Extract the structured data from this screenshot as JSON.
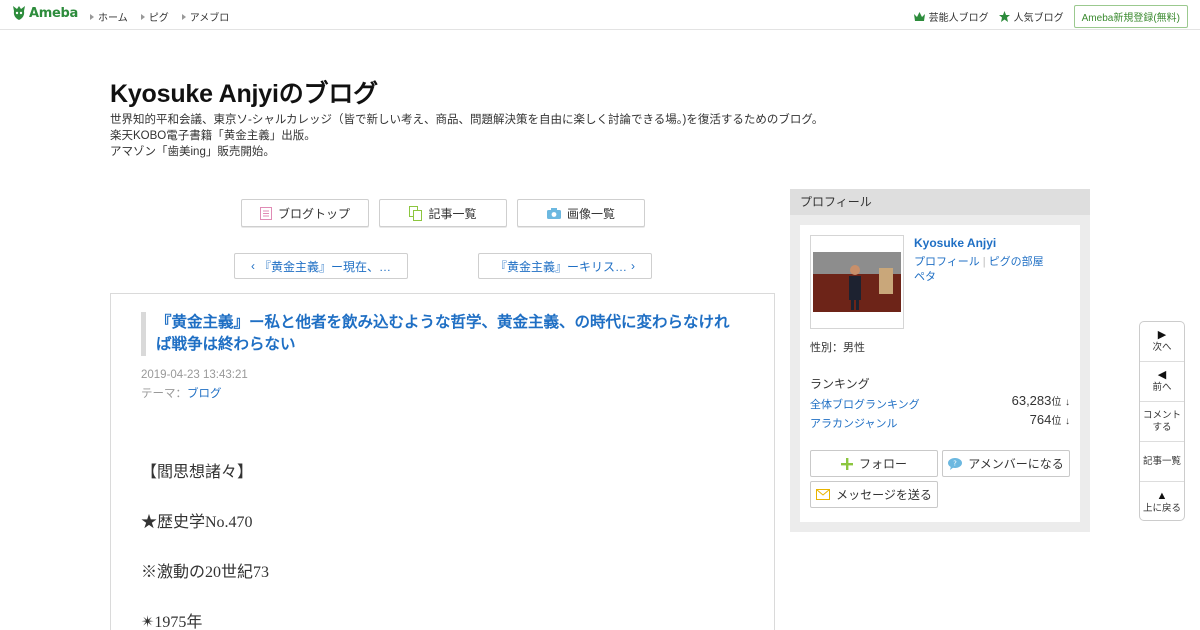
{
  "topbar": {
    "logo_text": "Ameba",
    "nav": [
      "ホーム",
      "ピグ",
      "アメブロ"
    ],
    "celebrity_blog": "芸能人ブログ",
    "popular_blog": "人気ブログ",
    "register": "Ameba新規登録(無料)"
  },
  "header": {
    "title": "Kyosuke Anjyiのブログ",
    "desc_line1": "世界知的平和会議、東京ソ-シャルカレッジ（皆で新しい考え、商品、問題解決策を自由に楽しく討論できる場。)を復活するためのブログ。",
    "desc_line2": "楽天KOBO電子書籍「黄金主義」出版。",
    "desc_line3": "アマゾン「歯美ing」販売開始。"
  },
  "nav_buttons": {
    "blog_top": "ブログトップ",
    "article_list": "記事一覧",
    "image_list": "画像一覧"
  },
  "pager": {
    "prev": "『黄金主義』ー現在、…",
    "next": "『黄金主義』ーキリス…"
  },
  "article": {
    "title": "『黄金主義』ー私と他者を飲み込むような哲学、黄金主義、の時代に変わらなければ戦争は終わらない",
    "date": "2019-04-23 13:43:21",
    "theme_label": "テーマ：",
    "theme": "ブログ",
    "body": [
      "【閻思想諸々】",
      "★歴史学No.470",
      "※激動の20世紀73",
      "✴1975年"
    ]
  },
  "sidebar": {
    "heading": "プロフィール",
    "name": "Kyosuke Anjyi",
    "link_profile": "プロフィール",
    "link_pigg": "ピグの部屋",
    "link_peta": "ペタ",
    "sex": "性別：男性",
    "ranking_heading": "ランキング",
    "rank_all_label": "全体ブログランキング",
    "rank_all_value": "63,283",
    "rank_genre_label": "アラカンジャンル",
    "rank_genre_value": "764",
    "rank_unit": "位",
    "rank_arrow": "↓",
    "follow": "フォロー",
    "amember": "アメンバーになる",
    "message": "メッセージを送る"
  },
  "float_menu": {
    "next": "次へ",
    "prev": "前へ",
    "comment_1": "コメント",
    "comment_2": "する",
    "list": "記事一覧",
    "top": "上に戻る"
  },
  "colors": {
    "link": "#1f6fc4",
    "brand_green": "#2d8c3c",
    "follow_plus": "#8cc63f"
  }
}
